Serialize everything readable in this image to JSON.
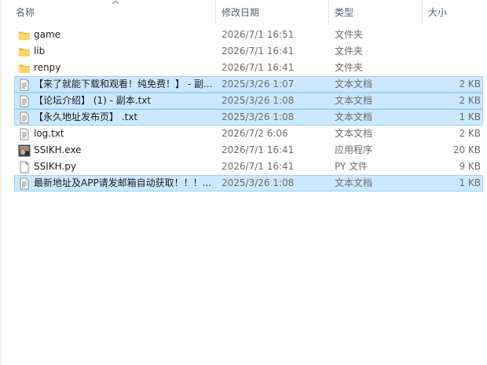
{
  "columns": {
    "name": "名称",
    "date": "修改日期",
    "type": "类型",
    "size": "大小"
  },
  "files": [
    {
      "name": "game",
      "date": "2026/7/1 16:51",
      "type": "文件夹",
      "size": "",
      "icon": "folder-icon",
      "selected": false
    },
    {
      "name": "lib",
      "date": "2026/7/1 16:41",
      "type": "文件夹",
      "size": "",
      "icon": "folder-icon",
      "selected": false
    },
    {
      "name": "renpy",
      "date": "2026/7/1 16:41",
      "type": "文件夹",
      "size": "",
      "icon": "folder-icon",
      "selected": false
    },
    {
      "name": "【来了就能下载和观看！纯免费！】 - 副...",
      "date": "2025/3/26 1:07",
      "type": "文本文档",
      "size": "2 KB",
      "icon": "text-file-icon",
      "selected": true
    },
    {
      "name": "【论坛介绍】 (1) - 副本.txt",
      "date": "2025/3/26 1:08",
      "type": "文本文档",
      "size": "2 KB",
      "icon": "text-file-icon",
      "selected": true
    },
    {
      "name": "【永久地址发布页】 .txt",
      "date": "2025/3/26 1:08",
      "type": "文本文档",
      "size": "1 KB",
      "icon": "text-file-icon",
      "selected": true
    },
    {
      "name": "log.txt",
      "date": "2026/7/2 6:06",
      "type": "文本文档",
      "size": "2 KB",
      "icon": "text-file-icon",
      "selected": false
    },
    {
      "name": "SSIKH.exe",
      "date": "2026/7/1 16:41",
      "type": "应用程序",
      "size": "20 KB",
      "icon": "app-icon",
      "selected": false
    },
    {
      "name": "SSIKH.py",
      "date": "2026/7/1 16:41",
      "type": "PY 文件",
      "size": "9 KB",
      "icon": "blank-file-icon",
      "selected": false
    },
    {
      "name": "最新地址及APP请发邮箱自动获取！！！...",
      "date": "2025/3/26 1:08",
      "type": "文本文档",
      "size": "1 KB",
      "icon": "text-file-icon",
      "selected": true
    }
  ]
}
